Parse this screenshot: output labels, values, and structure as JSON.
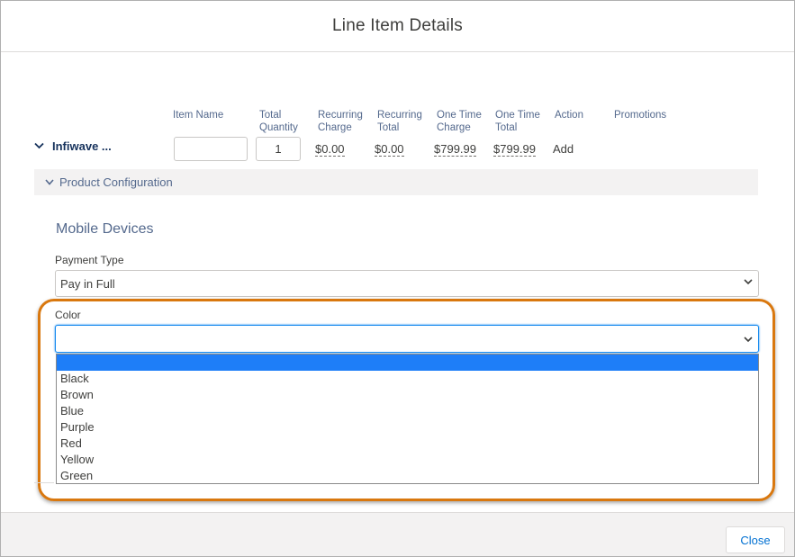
{
  "modal": {
    "title": "Line Item Details"
  },
  "columns": {
    "item_name": "Item Name",
    "total_quantity_1": "Total",
    "total_quantity_2": "Quantity",
    "recurring_charge_1": "Recurring",
    "recurring_charge_2": "Charge",
    "recurring_total_1": "Recurring",
    "recurring_total_2": "Total",
    "one_time_charge_1": "One Time",
    "one_time_charge_2": "Charge",
    "one_time_total_1": "One Time",
    "one_time_total_2": "Total",
    "action": "Action",
    "promotions": "Promotions"
  },
  "line_item": {
    "product_name": "Infiwave ...",
    "item_name_value": "",
    "quantity": "1",
    "recurring_charge": "$0.00",
    "recurring_total": "$0.00",
    "one_time_charge": "$799.99",
    "one_time_total": "$799.99",
    "action": "Add"
  },
  "section": {
    "label": "Product Configuration"
  },
  "config": {
    "group_title": "Mobile Devices",
    "payment_type_label": "Payment Type",
    "payment_type_value": "Pay in Full",
    "color_label": "Color",
    "color_value": "",
    "color_options": [
      "",
      "Black",
      "Brown",
      "Blue",
      "Purple",
      "Red",
      "Yellow",
      "Green"
    ]
  },
  "footer": {
    "close_label": "Close"
  },
  "colors": {
    "accent_blue": "#1589ee",
    "selected_option": "#1e7ef8",
    "highlight_ring": "#d9780f",
    "link_blue": "#0070d2"
  },
  "icons": {
    "row_toggle": "chevron-down-icon",
    "section_toggle": "chevron-down-icon",
    "select_chevron": "chevron-down-icon"
  }
}
